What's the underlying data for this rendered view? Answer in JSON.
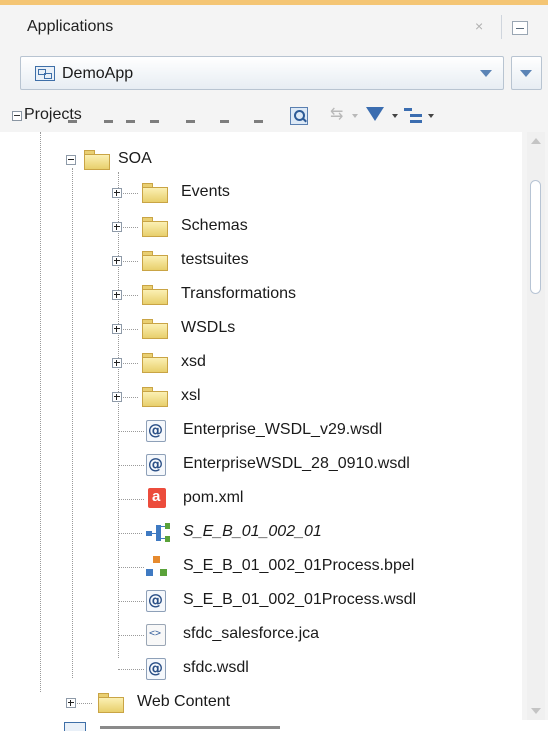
{
  "header": {
    "title": "Applications",
    "close_glyph": "×"
  },
  "app_selector": {
    "value": "DemoApp"
  },
  "projects": {
    "label": "Projects"
  },
  "tree": {
    "soa_folder": "SOA",
    "folders": [
      "Events",
      "Schemas",
      "testsuites",
      "Transformations",
      "WSDLs",
      "xsd",
      "xsl"
    ],
    "files": [
      {
        "name": "Enterprise_WSDL_v29.wsdl",
        "icon": "wsdl-icon"
      },
      {
        "name": "EnterpriseWSDL_28_0910.wsdl",
        "icon": "wsdl-icon"
      },
      {
        "name": "pom.xml",
        "icon": "pom-icon"
      },
      {
        "name": "S_E_B_01_002_01",
        "icon": "composite-icon"
      },
      {
        "name": "S_E_B_01_002_01Process.bpel",
        "icon": "bpel-icon"
      },
      {
        "name": "S_E_B_01_002_01Process.wsdl",
        "icon": "wsdl-icon"
      },
      {
        "name": "sfdc_salesforce.jca",
        "icon": "jca-icon"
      },
      {
        "name": "sfdc.wsdl",
        "icon": "wsdl-icon"
      }
    ],
    "web_content": "Web Content"
  },
  "colors": {
    "accent": "#f4c574",
    "folder": "#e8cf6c",
    "link_blue": "#3b6db0",
    "pom_red": "#ec4c3c"
  }
}
